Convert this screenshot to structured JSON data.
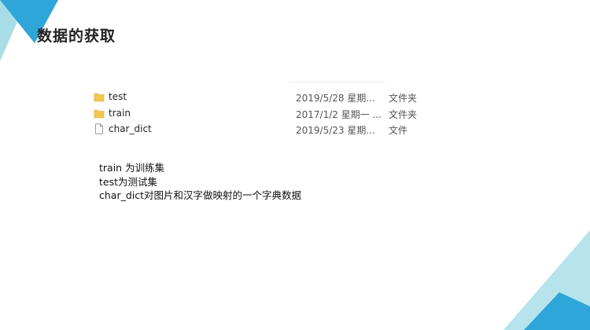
{
  "slide": {
    "title": "数据的获取"
  },
  "files": [
    {
      "name": "test",
      "date": "2019/5/28 星期...",
      "type": "文件夹",
      "icon": "folder-icon"
    },
    {
      "name": "train",
      "date": "2017/1/2 星期一 ...",
      "type": "文件夹",
      "icon": "folder-icon"
    },
    {
      "name": "char_dict",
      "date": "2019/5/23 星期...",
      "type": "文件",
      "icon": "file-icon"
    }
  ],
  "description": [
    "train 为训练集",
    "test为测试集",
    "char_dict对图片和汉字做映射的一个字典数据"
  ],
  "colors": {
    "accent_blue": "#2ea6d9",
    "accent_light": "#a8dde8",
    "folder_yellow": "#f3c74d"
  }
}
